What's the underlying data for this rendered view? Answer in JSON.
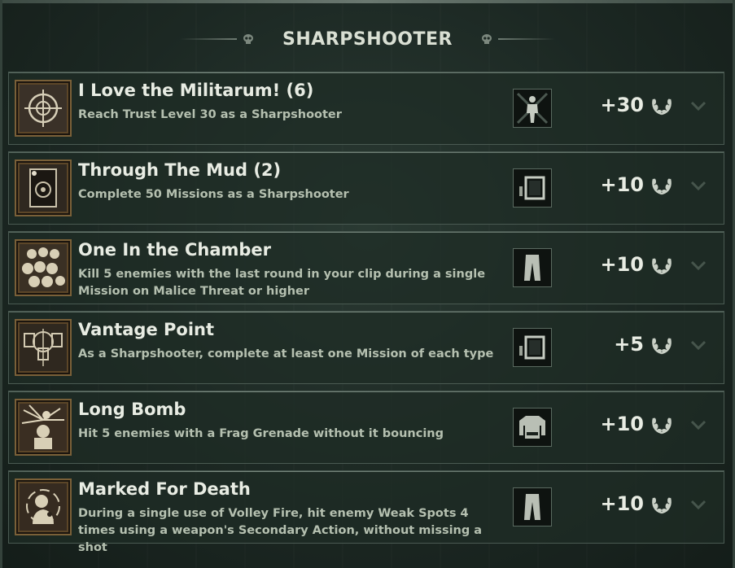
{
  "header": {
    "title": "SHARPSHOOTER"
  },
  "achievements": [
    {
      "title": "I Love the Militarum! (6)",
      "description": "Reach Trust Level 30 as a Sharpshooter",
      "reward_icon": "figure-portrait-icon",
      "points": "+30"
    },
    {
      "title": "Through The Mud (2)",
      "description": "Complete 50 Missions as a Sharpshooter",
      "reward_icon": "frame-icon",
      "points": "+10"
    },
    {
      "title": "One In the Chamber",
      "description": "Kill 5 enemies with the last round in your clip during a single Mission on Malice Threat or higher",
      "reward_icon": "trousers-icon",
      "points": "+10"
    },
    {
      "title": "Vantage Point",
      "description": "As a Sharpshooter, complete at least one Mission of each type",
      "reward_icon": "frame-icon",
      "points": "+5"
    },
    {
      "title": "Long Bomb",
      "description": "Hit 5 enemies with a Frag Grenade without it bouncing",
      "reward_icon": "shirt-icon",
      "points": "+10"
    },
    {
      "title": "Marked For Death",
      "description": "During a single use of Volley Fire, hit enemy Weak Spots 4 times using a weapon's Secondary Action, without missing a shot",
      "reward_icon": "trousers-icon",
      "points": "+10"
    }
  ],
  "colors": {
    "accent_gold": "#7a6038",
    "text": "#e8ece3",
    "subtext": "#b5c0b0"
  }
}
